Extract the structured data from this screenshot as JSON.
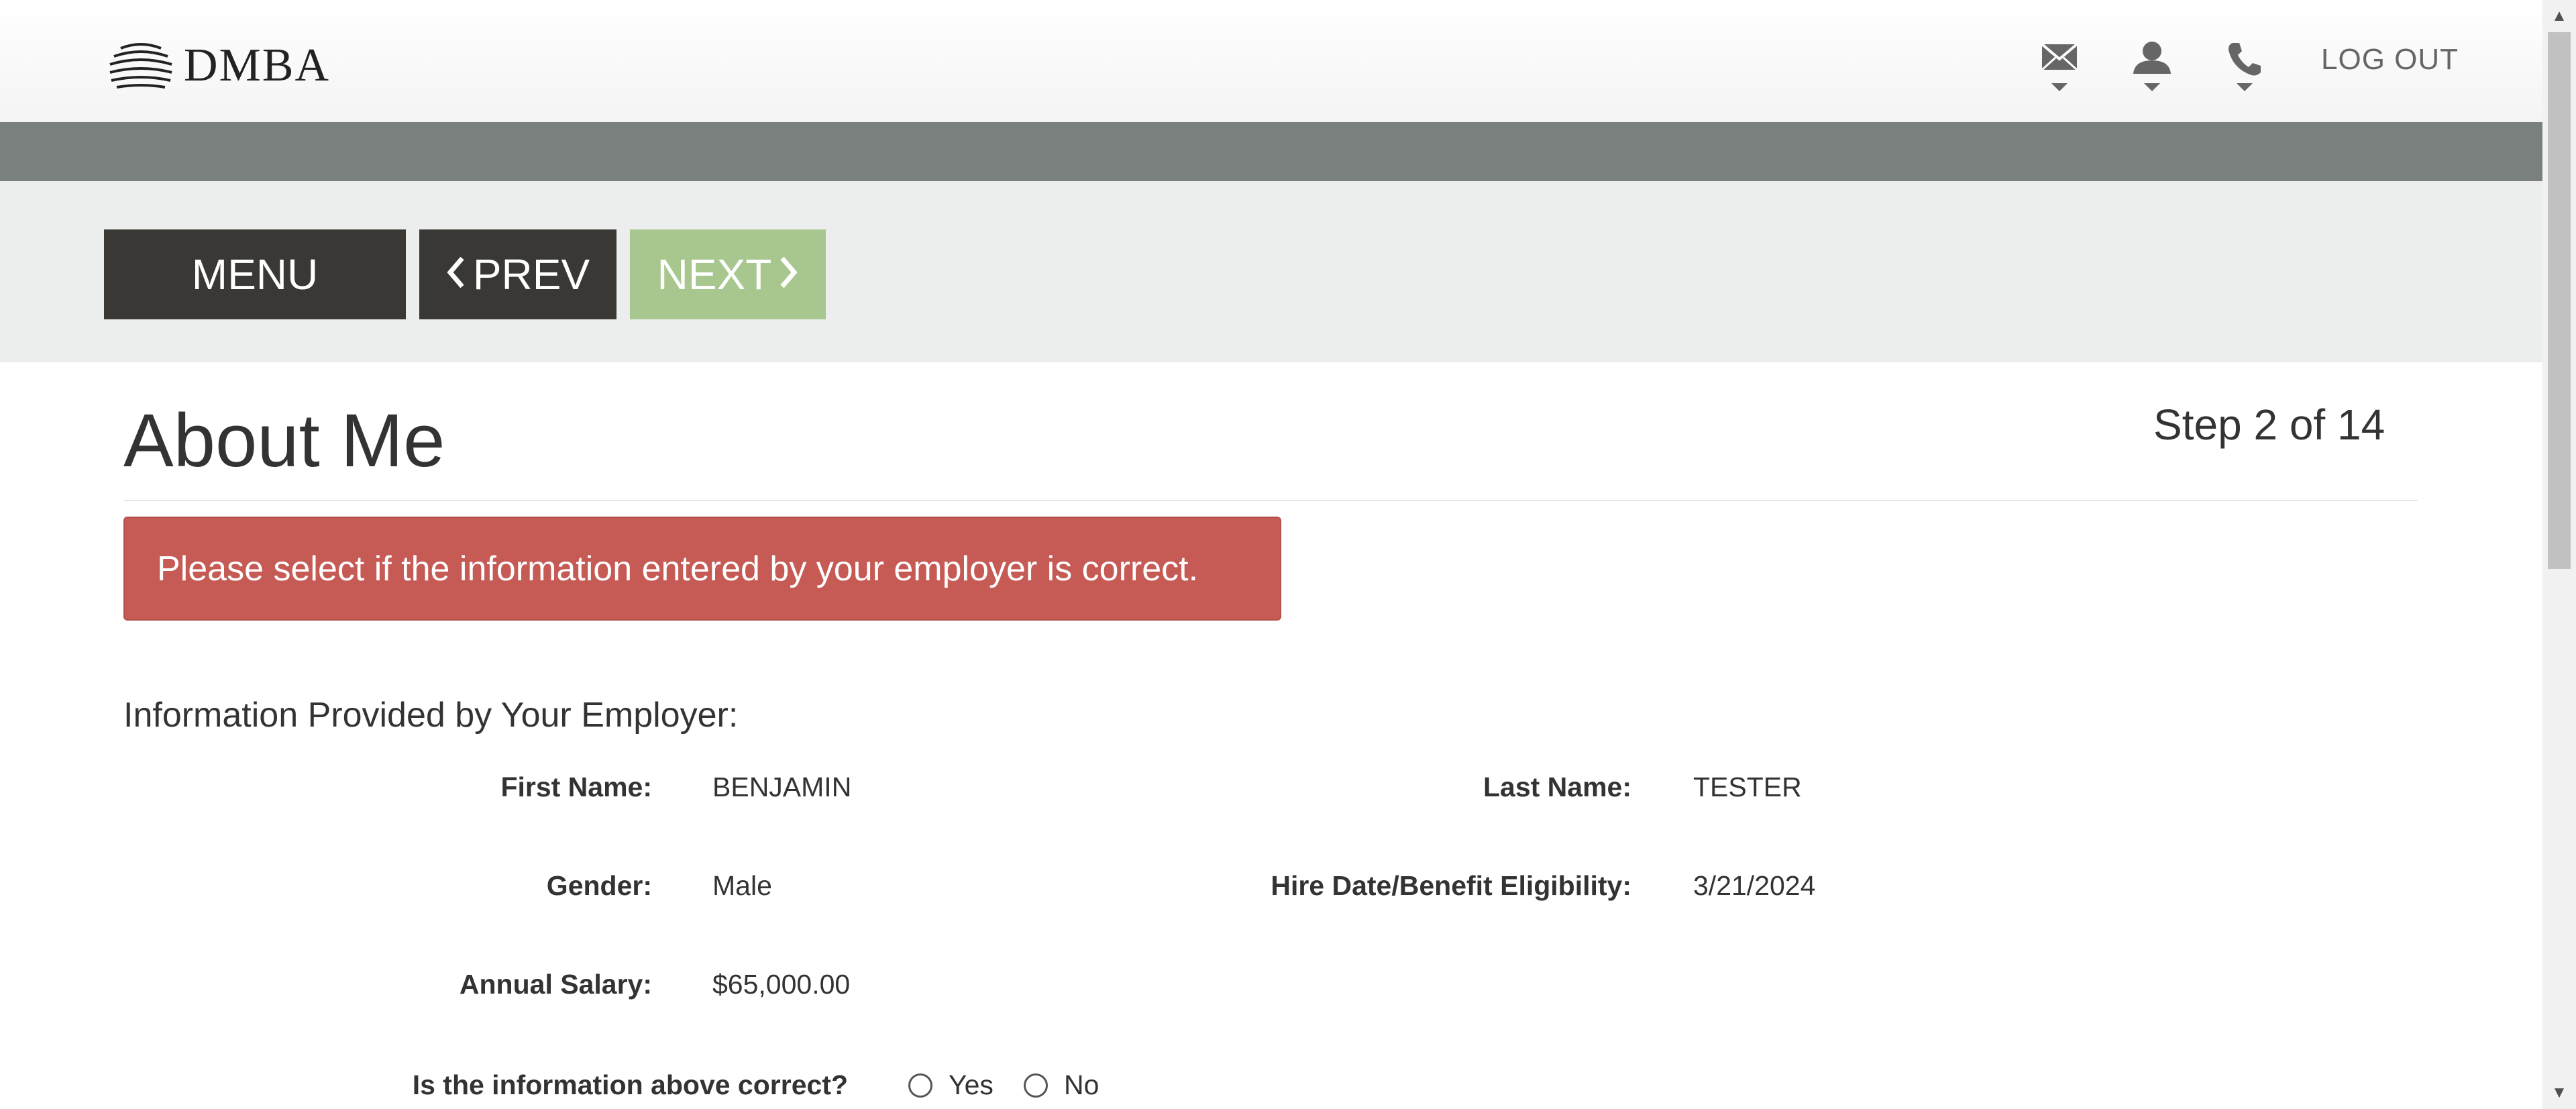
{
  "header": {
    "logo_text": "DMBA",
    "icons": [
      "mail-icon",
      "user-icon",
      "phone-icon"
    ],
    "logout_label": "LOG OUT"
  },
  "nav": {
    "menu_label": "MENU",
    "prev_label": "PREV",
    "next_label": "NEXT"
  },
  "page": {
    "title": "About Me",
    "step": "Step 2 of 14"
  },
  "alert": {
    "message": "Please select if the information entered by your employer is correct."
  },
  "employer_info": {
    "heading": "Information Provided by Your Employer:",
    "first_name_label": "First Name:",
    "first_name": "BENJAMIN",
    "last_name_label": "Last Name:",
    "last_name": "TESTER",
    "gender_label": "Gender:",
    "gender": "Male",
    "hire_date_label": "Hire Date/Benefit Eligibility:",
    "hire_date": "3/21/2024",
    "salary_label": "Annual Salary:",
    "salary": "$65,000.00"
  },
  "confirm": {
    "question": "Is the information above correct?",
    "options": [
      "Yes",
      "No"
    ],
    "selected": null
  },
  "colors": {
    "dark_button": "#3a3834",
    "next_button": "#a8c78e",
    "alert_bg": "#c65a55",
    "grey_bar": "#7a807d",
    "band_bg": "#eceeed"
  }
}
